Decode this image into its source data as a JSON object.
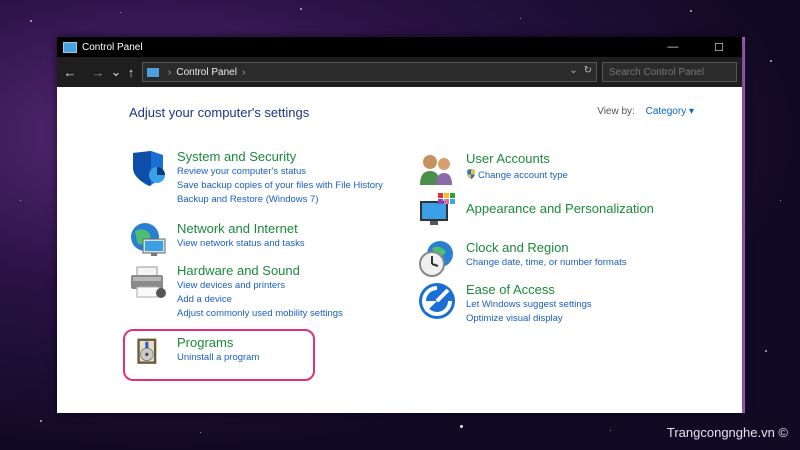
{
  "window": {
    "title": "Control Panel",
    "minimize_icon": "minimize-icon",
    "maximize_icon": "maximize-icon"
  },
  "nav": {
    "back": "←",
    "forward": "→",
    "recent": "⌄",
    "up": "↑",
    "address_path": "Control Panel",
    "search_placeholder": "Search Control Panel"
  },
  "main": {
    "heading": "Adjust your computer's settings",
    "view_by_label": "View by:",
    "view_by_value": "Category ▾"
  },
  "categories": [
    {
      "title": "System and Security",
      "icon": "shield-icon",
      "links": [
        "Review your computer's status",
        "Save backup copies of your files with File History",
        "Backup and Restore (Windows 7)"
      ]
    },
    {
      "title": "Network and Internet",
      "icon": "network-icon",
      "links": [
        "View network status and tasks"
      ]
    },
    {
      "title": "Hardware and Sound",
      "icon": "printer-icon",
      "links": [
        "View devices and printers",
        "Add a device",
        "Adjust commonly used mobility settings"
      ]
    },
    {
      "title": "Programs",
      "icon": "programs-icon",
      "links": [
        "Uninstall a program"
      ]
    },
    {
      "title": "User Accounts",
      "icon": "users-icon",
      "links": [
        "Change account type"
      ]
    },
    {
      "title": "Appearance and Personalization",
      "icon": "appearance-icon",
      "links": []
    },
    {
      "title": "Clock and Region",
      "icon": "clock-icon",
      "links": [
        "Change date, time, or number formats"
      ]
    },
    {
      "title": "Ease of Access",
      "icon": "ease-of-access-icon",
      "links": [
        "Let Windows suggest settings",
        "Optimize visual display"
      ]
    }
  ],
  "watermark": "Trangcongnghe.vn ©",
  "colors": {
    "accent_green": "#1a8a3a",
    "link_blue": "#1a5fbf",
    "heading_blue": "#1e3287",
    "highlight": "#e0307a"
  }
}
